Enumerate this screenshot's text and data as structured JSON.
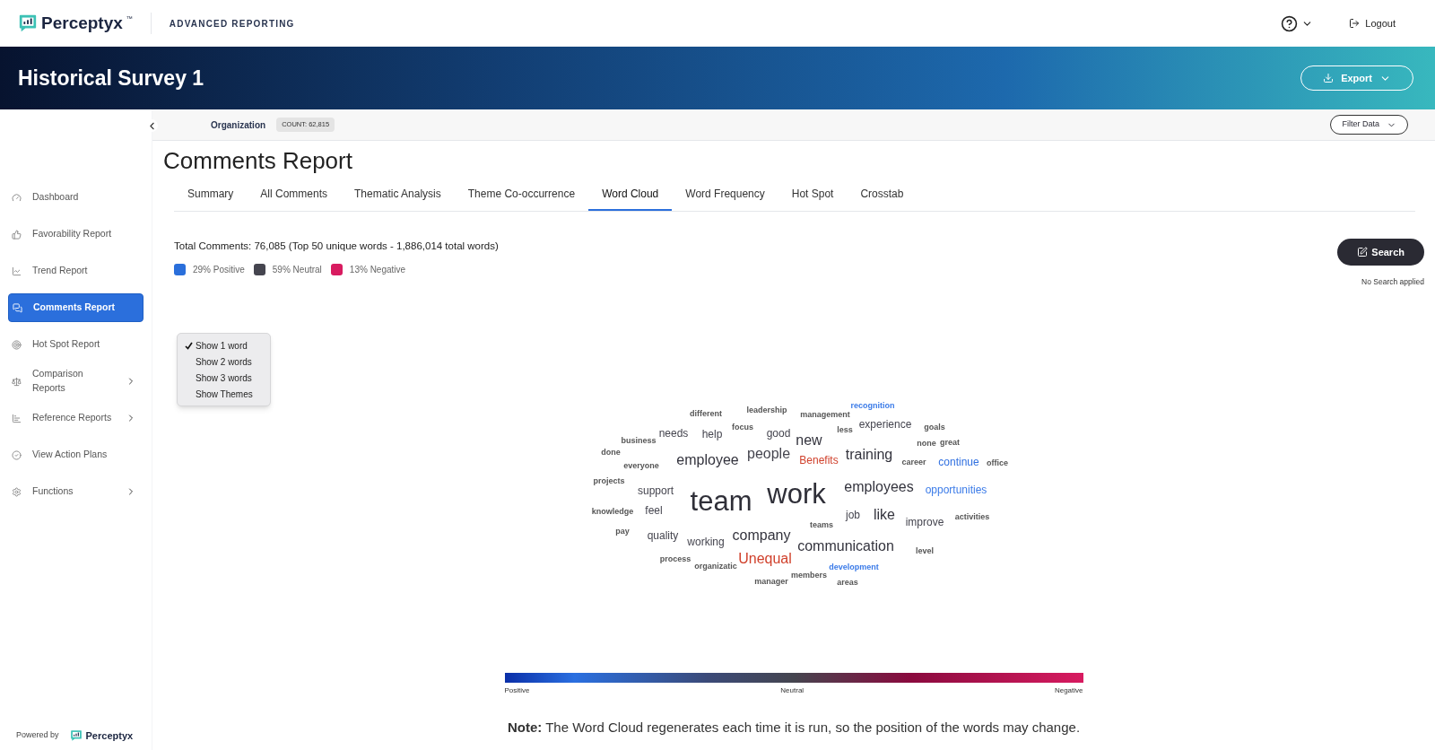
{
  "header": {
    "logo_text": "Perceptyx",
    "logo_mark": "™",
    "product": "ADVANCED REPORTING",
    "logout": "Logout"
  },
  "banner": {
    "title": "Historical Survey 1",
    "export_button": "Export"
  },
  "filter_bar": {
    "label": "Organization",
    "count": "COUNT: 62,815",
    "filter_button": "Filter Data"
  },
  "sidebar": {
    "items": [
      {
        "label": "Dashboard",
        "selected": false,
        "has_submenu": false
      },
      {
        "label": "Favorability Report",
        "selected": false,
        "has_submenu": false
      },
      {
        "label": "Trend Report",
        "selected": false,
        "has_submenu": false
      },
      {
        "label": "Comments Report",
        "selected": true,
        "has_submenu": false
      },
      {
        "label": "Hot Spot Report",
        "selected": false,
        "has_submenu": false
      },
      {
        "label": "Comparison Reports",
        "selected": false,
        "has_submenu": true
      },
      {
        "label": "Reference Reports",
        "selected": false,
        "has_submenu": true
      },
      {
        "label": "View Action Plans",
        "selected": false,
        "has_submenu": false
      },
      {
        "label": "Functions",
        "selected": false,
        "has_submenu": true
      }
    ],
    "powered_by": "Powered by",
    "powered_logo": "Perceptyx"
  },
  "page_title": "Comments Report",
  "tabs": [
    {
      "label": "Summary",
      "selected": false
    },
    {
      "label": "All Comments",
      "selected": false
    },
    {
      "label": "Thematic Analysis",
      "selected": false
    },
    {
      "label": "Theme Co-occurrence",
      "selected": false
    },
    {
      "label": "Word Cloud",
      "selected": true
    },
    {
      "label": "Word Frequency",
      "selected": false
    },
    {
      "label": "Hot Spot",
      "selected": false
    },
    {
      "label": "Crosstab",
      "selected": false
    }
  ],
  "summary": {
    "total": "Total Comments: 76,085 (Top 50 unique words - 1,886,014 total words)",
    "legend": [
      {
        "label": "29% Positive",
        "color": "#2a6fdb"
      },
      {
        "label": "59% Neutral",
        "color": "#45454f"
      },
      {
        "label": "13% Negative",
        "color": "#d81b60"
      }
    ]
  },
  "search_button": "Search",
  "search_status": "No Search applied",
  "word_mode_menu": [
    {
      "label": "Show 1 word",
      "selected": true
    },
    {
      "label": "Show 2 words",
      "selected": false
    },
    {
      "label": "Show 3 words",
      "selected": false
    },
    {
      "label": "Show Themes",
      "selected": false
    }
  ],
  "word_cloud": {
    "words": [
      {
        "text": "different",
        "kind": "xs",
        "color": "#555555"
      },
      {
        "text": "leadership",
        "kind": "xs",
        "color": "#555555"
      },
      {
        "text": "management",
        "kind": "xs",
        "color": "#555555"
      },
      {
        "text": "recognition",
        "kind": "xs",
        "color": "#3b7be8"
      },
      {
        "text": "focus",
        "kind": "xs",
        "color": "#555555"
      },
      {
        "text": "needs",
        "kind": "md",
        "color": "#44444e"
      },
      {
        "text": "help",
        "kind": "md",
        "color": "#44444e"
      },
      {
        "text": "good",
        "kind": "md",
        "color": "#44444e"
      },
      {
        "text": "less",
        "kind": "xs",
        "color": "#555555"
      },
      {
        "text": "experience",
        "kind": "md",
        "color": "#44444e"
      },
      {
        "text": "goals",
        "kind": "xs",
        "color": "#555555"
      },
      {
        "text": "business",
        "kind": "xs",
        "color": "#555555"
      },
      {
        "text": "new",
        "kind": "lg",
        "color": "#33333d"
      },
      {
        "text": "none",
        "kind": "xs",
        "color": "#555555"
      },
      {
        "text": "great",
        "kind": "xs",
        "color": "#555555"
      },
      {
        "text": "done",
        "kind": "xs",
        "color": "#555555"
      },
      {
        "text": "employee",
        "kind": "lg",
        "color": "#33333d"
      },
      {
        "text": "people",
        "kind": "lg",
        "color": "#44444e"
      },
      {
        "text": "Benefits",
        "kind": "md",
        "color": "#d0402b"
      },
      {
        "text": "training",
        "kind": "lg",
        "color": "#33333d"
      },
      {
        "text": "career",
        "kind": "xs",
        "color": "#555555"
      },
      {
        "text": "continue",
        "kind": "md",
        "color": "#2f6fe0"
      },
      {
        "text": "office",
        "kind": "xs",
        "color": "#555555"
      },
      {
        "text": "everyone",
        "kind": "xs",
        "color": "#555555"
      },
      {
        "text": "projects",
        "kind": "xs",
        "color": "#555555"
      },
      {
        "text": "support",
        "kind": "md",
        "color": "#44444e"
      },
      {
        "text": "team",
        "kind": "xl",
        "color": "#2f2f38"
      },
      {
        "text": "work",
        "kind": "xl",
        "color": "#2f2f38"
      },
      {
        "text": "employees",
        "kind": "lg",
        "color": "#33333d"
      },
      {
        "text": "opportunities",
        "kind": "md",
        "color": "#3b7be8"
      },
      {
        "text": "knowledge",
        "kind": "xs",
        "color": "#555555"
      },
      {
        "text": "feel",
        "kind": "md",
        "color": "#44444e"
      },
      {
        "text": "job",
        "kind": "md",
        "color": "#44444e"
      },
      {
        "text": "like",
        "kind": "lg",
        "color": "#33333d"
      },
      {
        "text": "improve",
        "kind": "md",
        "color": "#44444e"
      },
      {
        "text": "activities",
        "kind": "xs",
        "color": "#555555"
      },
      {
        "text": "teams",
        "kind": "xs",
        "color": "#555555"
      },
      {
        "text": "pay",
        "kind": "xs",
        "color": "#555555"
      },
      {
        "text": "quality",
        "kind": "md",
        "color": "#44444e"
      },
      {
        "text": "working",
        "kind": "md",
        "color": "#44444e"
      },
      {
        "text": "company",
        "kind": "lg",
        "color": "#33333d"
      },
      {
        "text": "communication",
        "kind": "lg",
        "color": "#33333d"
      },
      {
        "text": "level",
        "kind": "xs",
        "color": "#555555"
      },
      {
        "text": "process",
        "kind": "xs",
        "color": "#555555"
      },
      {
        "text": "organizatic",
        "kind": "xs",
        "color": "#555555"
      },
      {
        "text": "Unequal",
        "kind": "lg",
        "color": "#d0402b"
      },
      {
        "text": "development",
        "kind": "xs",
        "color": "#3b7be8"
      },
      {
        "text": "members",
        "kind": "xs",
        "color": "#555555"
      },
      {
        "text": "manager",
        "kind": "xs",
        "color": "#555555"
      },
      {
        "text": "areas",
        "kind": "xs",
        "color": "#555555"
      }
    ]
  },
  "scale": {
    "labels": [
      "Positive",
      "Neutral",
      "Negative"
    ]
  },
  "note": "**Note:** The Word Cloud regenerates each time it is run, so the position of the words may change."
}
